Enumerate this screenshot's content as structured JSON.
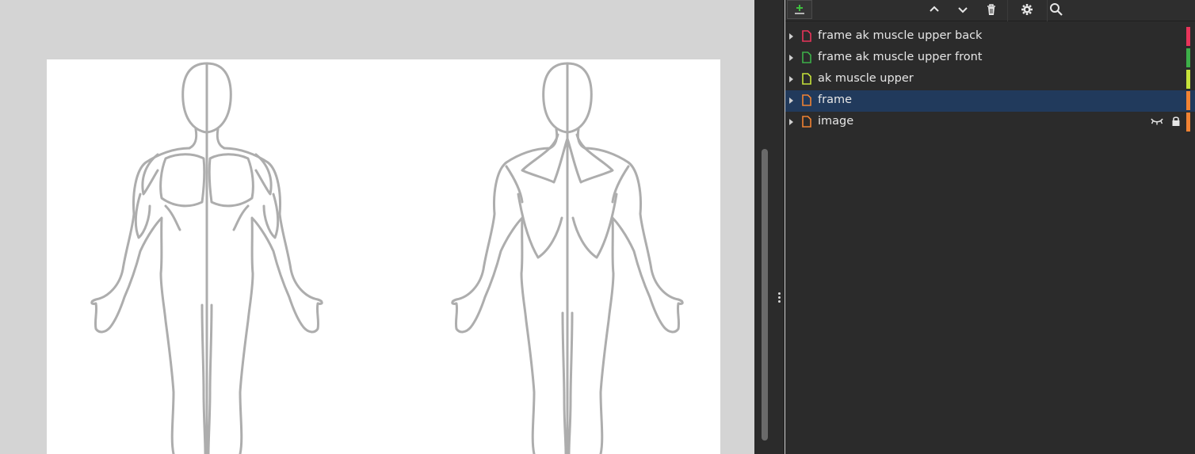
{
  "canvas": {
    "figures": [
      "front-body-figure",
      "back-body-figure"
    ]
  },
  "toolbar": {
    "icons": [
      "add-layer-icon",
      "move-up-icon",
      "move-down-icon",
      "trash-icon",
      "gear-icon",
      "search-icon"
    ],
    "add_color": "#3fbf3f"
  },
  "layers": [
    {
      "name": "frame ak muscle upper back",
      "color": "#e8345a",
      "selected": false,
      "hidden": false,
      "locked": false
    },
    {
      "name": "frame ak muscle upper front",
      "color": "#3db049",
      "selected": false,
      "hidden": false,
      "locked": false
    },
    {
      "name": "ak muscle upper",
      "color": "#c6e23a",
      "selected": false,
      "hidden": false,
      "locked": false
    },
    {
      "name": "frame",
      "color": "#f08233",
      "selected": true,
      "hidden": false,
      "locked": false
    },
    {
      "name": "image",
      "color": "#f08233",
      "selected": false,
      "hidden": true,
      "locked": true
    }
  ]
}
